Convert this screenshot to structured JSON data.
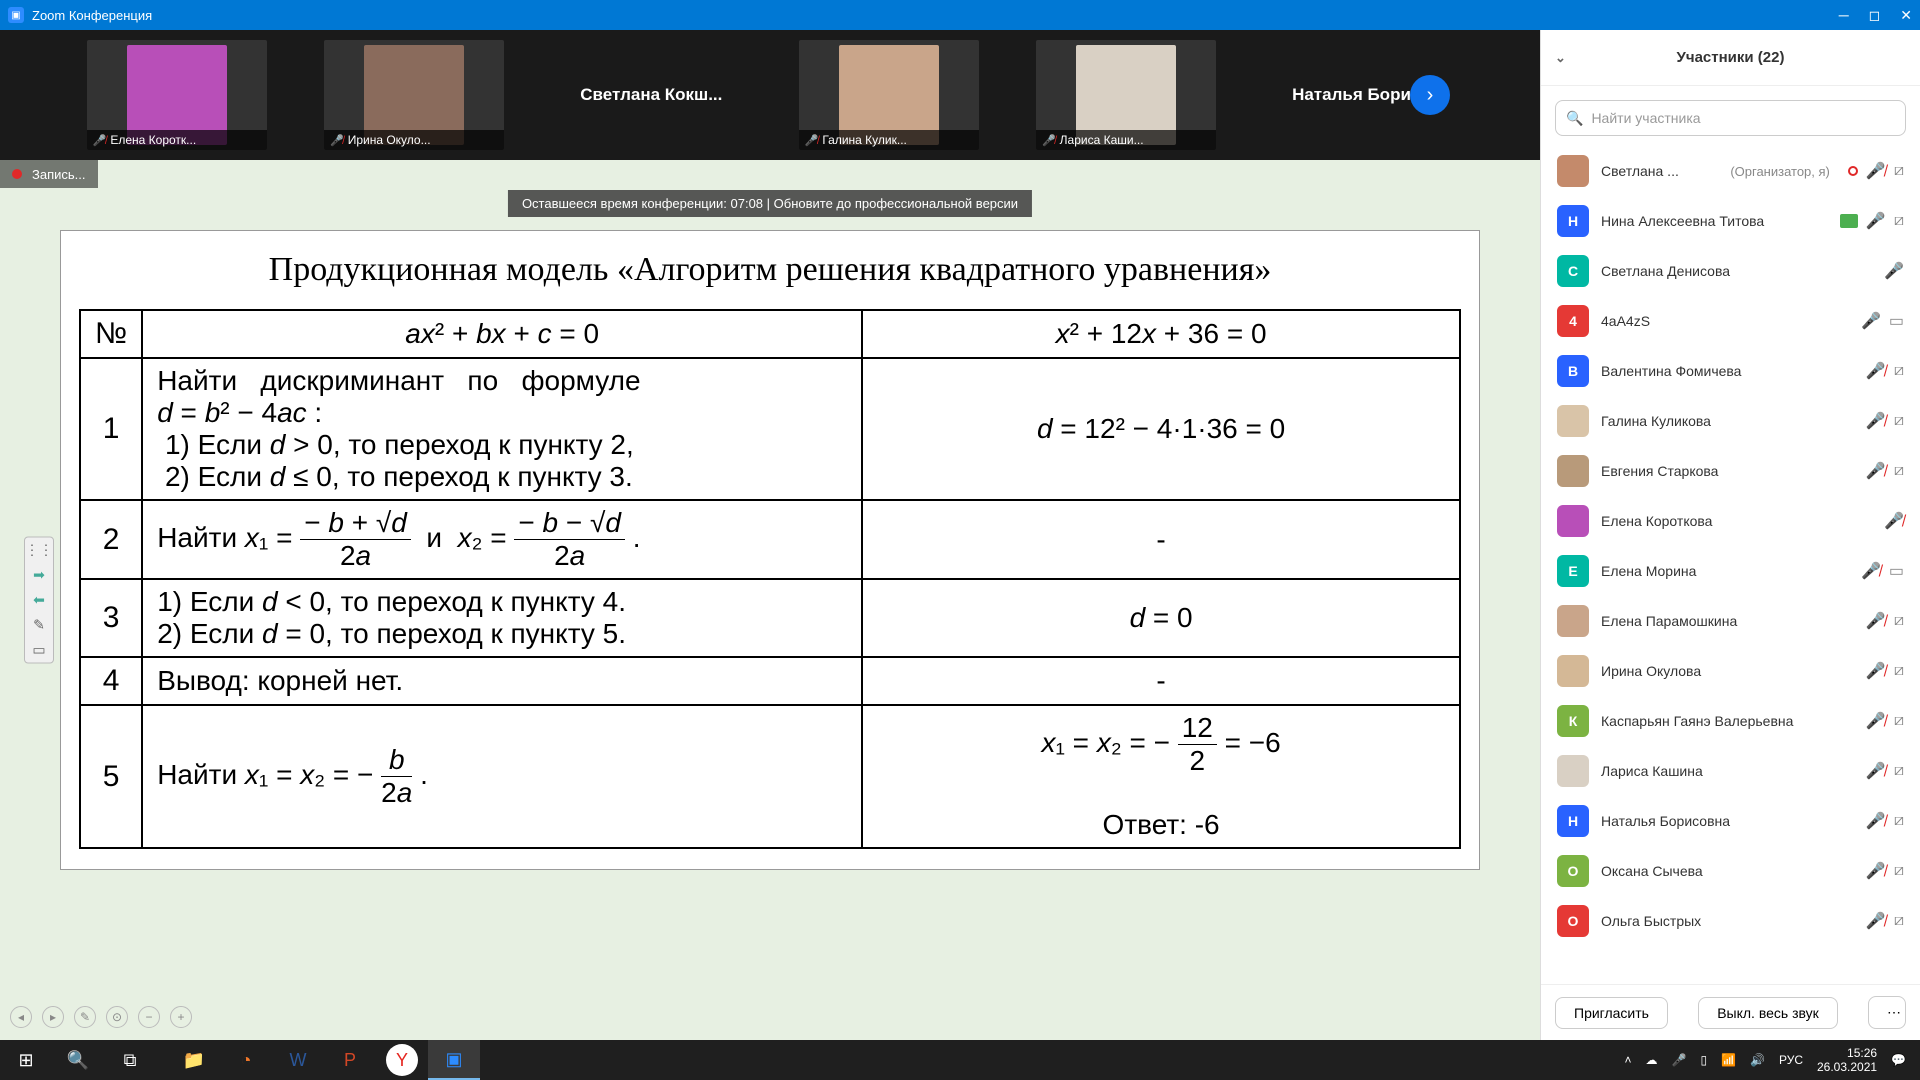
{
  "titlebar": {
    "app": "Zoom Конференция"
  },
  "gallery": {
    "tiles": [
      {
        "type": "thumb",
        "name": "Елена Коротк...",
        "thumb": "#b84fb8"
      },
      {
        "type": "thumb",
        "name": "Ирина Окуло...",
        "thumb": "#8a6b5c"
      },
      {
        "type": "text",
        "label": "Светлана  Кокш..."
      },
      {
        "type": "thumb",
        "name": "Галина Кулик...",
        "thumb": "#c9a58a"
      },
      {
        "type": "thumb",
        "name": "Лариса Каши...",
        "thumb": "#d9d0c4"
      },
      {
        "type": "text",
        "label": "Наталья  Борис..."
      }
    ]
  },
  "recording": "Запись...",
  "timebar": "Оставшееся время конференции: 07:08 | Обновите до профессиональной версии",
  "slide": {
    "title": "Продукционная модель «Алгоритм решения квадратного уравнения»",
    "h_num": "№",
    "h_c2": "ax² + bx + c = 0",
    "h_c3": "x² + 12x + 36 = 0",
    "r1_n": "1",
    "r1_c2": "Найти дискриминант по формуле d = b² − 4ac :\n 1) Если d > 0, то переход к пункту 2,\n 2) Если d ≤ 0, то переход к пункту 3.",
    "r1_c3": "d = 12² − 4·1·36 = 0",
    "r2_n": "2",
    "r2_c2": "Найти x₁ = (−b + √d) / 2a  и  x₂ = (−b − √d) / 2a .",
    "r2_c3": "-",
    "r3_n": "3",
    "r3_c2": "1) Если d < 0, то переход к пункту 4.\n2) Если d = 0, то переход к пункту 5.",
    "r3_c3": "d = 0",
    "r4_n": "4",
    "r4_c2": "Вывод: корней нет.",
    "r4_c3": "-",
    "r5_n": "5",
    "r5_c2": "Найти x₁ = x₂ = − b / 2a .",
    "r5_c3": "x₁ = x₂ = − 12/2 = −6\nОтвет: -6"
  },
  "panel": {
    "title": "Участники (22)",
    "search_placeholder": "Найти участника",
    "list": [
      {
        "avatar": "img",
        "color": "#c48a6b",
        "name": "Светлана ...",
        "role": "(Организатор, я)",
        "icons": [
          "rec",
          "mic-muted",
          "cam-off"
        ]
      },
      {
        "avatar": "Н",
        "color": "#2962ff",
        "name": "Нина Алексеевна Титова",
        "icons": [
          "share",
          "mic-on",
          "cam-off"
        ]
      },
      {
        "avatar": "С",
        "color": "#00b8a3",
        "name": "Светлана Денисова",
        "icons": [
          "mic-on"
        ]
      },
      {
        "avatar": "4",
        "color": "#e53935",
        "name": "4aA4zS",
        "icons": [
          "mic-on",
          "cam"
        ]
      },
      {
        "avatar": "В",
        "color": "#2962ff",
        "name": "Валентина Фомичева",
        "icons": [
          "mic-muted",
          "cam-off"
        ]
      },
      {
        "avatar": "img",
        "color": "#d9c4a8",
        "name": "Галина Куликова",
        "icons": [
          "mic-muted",
          "cam-off"
        ]
      },
      {
        "avatar": "img",
        "color": "#b89a7a",
        "name": "Евгения Старкова",
        "icons": [
          "mic-muted",
          "cam-off"
        ]
      },
      {
        "avatar": "img",
        "color": "#b84fb8",
        "name": "Елена Короткова",
        "icons": [
          "mic-muted"
        ]
      },
      {
        "avatar": "Е",
        "color": "#00b8a3",
        "name": "Елена Морина",
        "icons": [
          "mic-muted",
          "cam"
        ]
      },
      {
        "avatar": "img",
        "color": "#c9a58a",
        "name": "Елена Парамошкина",
        "icons": [
          "mic-muted",
          "cam-off"
        ]
      },
      {
        "avatar": "img",
        "color": "#d4b896",
        "name": "Ирина Окулова",
        "icons": [
          "mic-muted",
          "cam-off"
        ]
      },
      {
        "avatar": "К",
        "color": "#7cb342",
        "name": "Каспарьян Гаянэ Валерьевна",
        "icons": [
          "mic-muted",
          "cam-off"
        ]
      },
      {
        "avatar": "img",
        "color": "#d9d0c4",
        "name": "Лариса Кашина",
        "icons": [
          "mic-muted",
          "cam-off"
        ]
      },
      {
        "avatar": "Н",
        "color": "#2962ff",
        "name": "Наталья Борисовна",
        "icons": [
          "mic-muted",
          "cam-off"
        ]
      },
      {
        "avatar": "О",
        "color": "#7cb342",
        "name": "Оксана Сычева",
        "icons": [
          "mic-muted",
          "cam-off"
        ]
      },
      {
        "avatar": "О",
        "color": "#e53935",
        "name": "Ольга Быстрых",
        "icons": [
          "mic-muted",
          "cam-off"
        ]
      }
    ],
    "invite": "Пригласить",
    "muteall": "Выкл. весь звук"
  },
  "taskbar": {
    "lang": "РУС",
    "time": "15:26",
    "date": "26.03.2021"
  }
}
